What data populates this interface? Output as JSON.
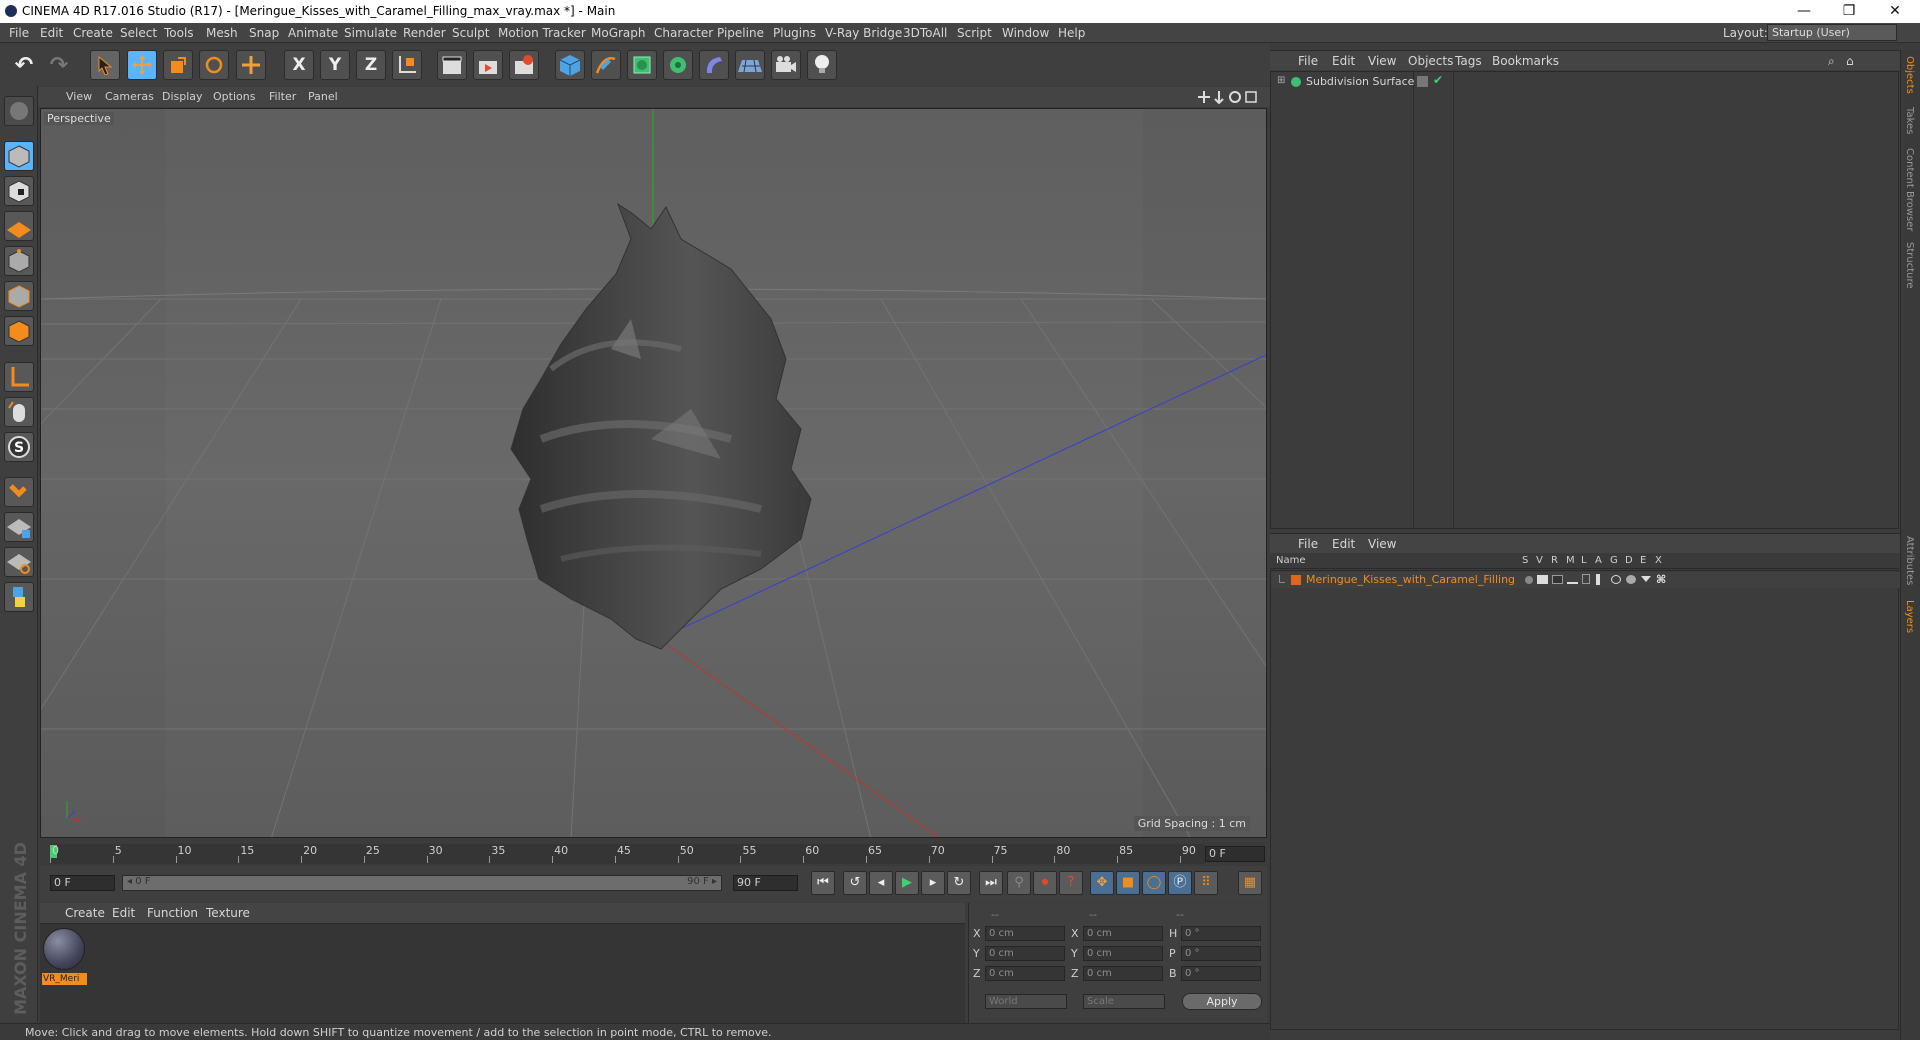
{
  "window": {
    "title": "CINEMA 4D R17.016 Studio (R17) - [Meringue_Kisses_with_Caramel_Filling_max_vray.max *] - Main",
    "minimize": "—",
    "restore": "❐",
    "close": "✕"
  },
  "menubar": {
    "items": [
      "File",
      "Edit",
      "Create",
      "Select",
      "Tools",
      "Mesh",
      "Snap",
      "Animate",
      "Simulate",
      "Render",
      "Sculpt",
      "Motion Tracker",
      "MoGraph",
      "Character",
      "Pipeline",
      "Plugins",
      "V-Ray Bridge",
      "3DToAll",
      "Script",
      "Window",
      "Help"
    ],
    "layout_label": "Layout:",
    "layout_value": "Startup (User)"
  },
  "toolbar": {
    "undo": "↶",
    "redo": "↷",
    "axis_x": "X",
    "axis_y": "Y",
    "axis_z": "Z"
  },
  "viewport": {
    "menu": [
      "View",
      "Cameras",
      "Display",
      "Options",
      "Filter",
      "Panel"
    ],
    "camera_label": "Perspective",
    "grid_spacing": "Grid Spacing : 1 cm"
  },
  "timeline": {
    "ticks": [
      "0",
      "5",
      "10",
      "15",
      "20",
      "25",
      "30",
      "35",
      "40",
      "45",
      "50",
      "55",
      "60",
      "65",
      "70",
      "75",
      "80",
      "85",
      "90"
    ],
    "current_frame_field": "0 F",
    "start_field": "0 F",
    "range_start": "◂ 0 F",
    "range_end": "90 F ▸",
    "end_field": "90 F"
  },
  "material_manager": {
    "menu": [
      "Create",
      "Edit",
      "Function",
      "Texture"
    ],
    "material_name": "VR_Meri"
  },
  "coordinates": {
    "col_headers": [
      "--",
      "--",
      "--"
    ],
    "rows": [
      {
        "a_label": "X",
        "a_val": "0 cm",
        "b_label": "X",
        "b_val": "0 cm",
        "c_label": "H",
        "c_val": "0 °"
      },
      {
        "a_label": "Y",
        "a_val": "0 cm",
        "b_label": "Y",
        "b_val": "0 cm",
        "c_label": "P",
        "c_val": "0 °"
      },
      {
        "a_label": "Z",
        "a_val": "0 cm",
        "b_label": "Z",
        "b_val": "0 cm",
        "c_label": "B",
        "c_val": "0 °"
      }
    ],
    "world_select": "World",
    "scale_select": "Scale",
    "apply": "Apply"
  },
  "status": {
    "text": "Move: Click and drag to move elements. Hold down SHIFT to quantize movement / add to the selection in point mode, CTRL to remove."
  },
  "branding": {
    "logo": "MAXON CINEMA 4D"
  },
  "object_manager": {
    "menu": [
      "File",
      "Edit",
      "View",
      "Objects",
      "Tags",
      "Bookmarks"
    ],
    "object_name": "Subdivision Surface"
  },
  "layer_manager": {
    "menu": [
      "File",
      "Edit",
      "View"
    ],
    "columns": [
      "Name",
      "S",
      "V",
      "R",
      "M",
      "L",
      "A",
      "G",
      "D",
      "E",
      "X"
    ],
    "layer_name": "Meringue_Kisses_with_Caramel_Filling"
  },
  "side_tabs": [
    "Objects",
    "Takes",
    "Content Browser",
    "Structure",
    "Attributes",
    "Layers"
  ],
  "colors": {
    "accent_orange": "#f28c1c",
    "active_blue": "#5ab4ff",
    "x_axis": "#c0352b",
    "y_axis": "#2fa52f",
    "z_axis": "#3a3fd0"
  }
}
